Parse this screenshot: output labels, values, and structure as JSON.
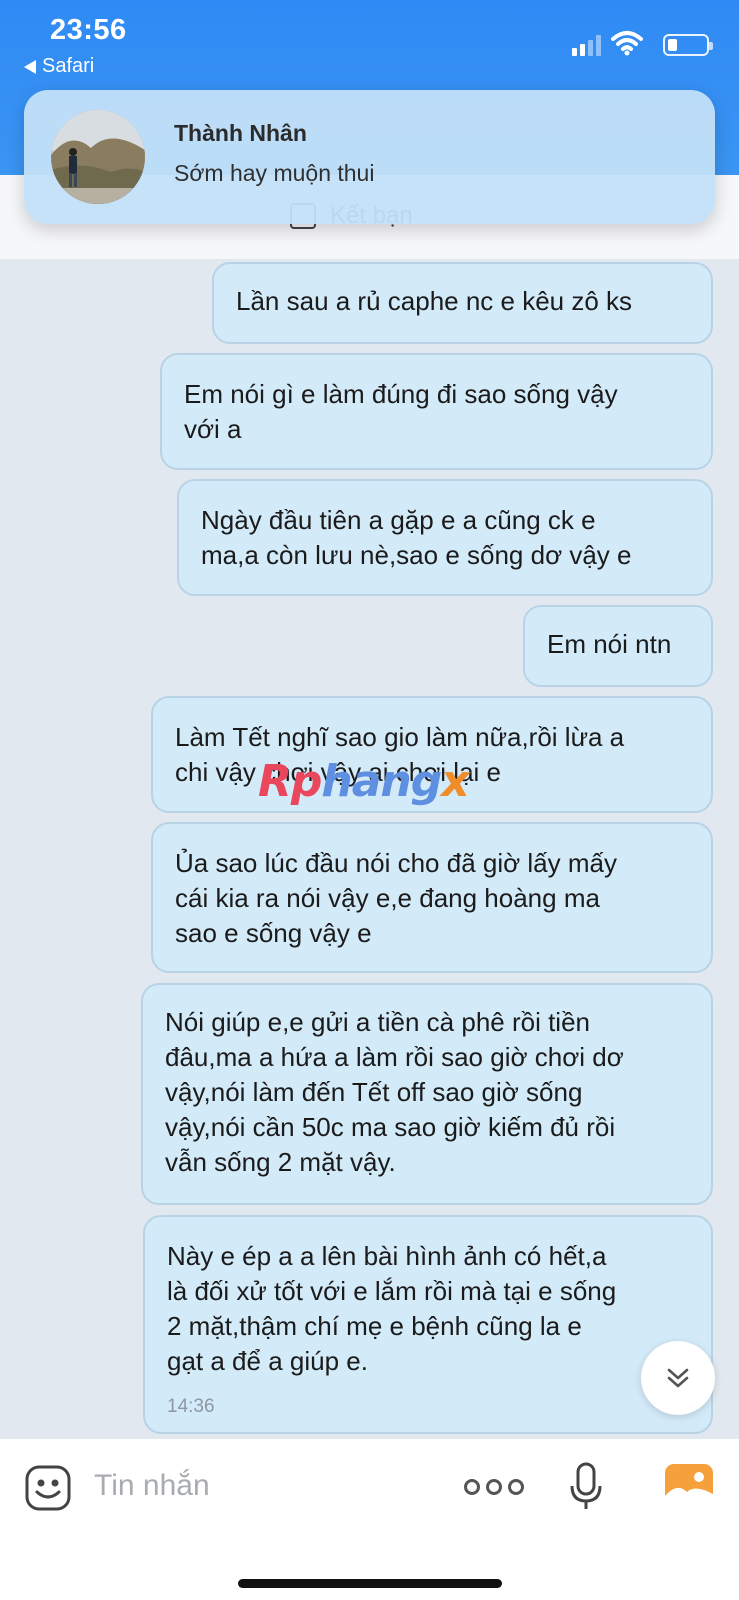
{
  "status": {
    "time": "23:56",
    "back_app": "Safari"
  },
  "notification": {
    "sender": "Thành Nhân",
    "message": "Sớm hay muộn thui"
  },
  "friend_bar": {
    "label": "Kết bạn"
  },
  "messages": [
    {
      "text": "Lần sau a rủ caphe nc e kêu zô ks"
    },
    {
      "text": "Em nói gì e làm đúng đi sao sống vậy\nvới a"
    },
    {
      "text": "Ngày đầu tiên a gặp e a cũng ck e\nma,a còn lưu nè,sao e sống dơ vậy e"
    },
    {
      "text": "Em nói ntn"
    },
    {
      "text": "Làm Tết nghĩ sao gio làm nữa,rồi lừa a\nchi vậy chơi vậy ai chơi lại e"
    },
    {
      "text": "Ủa sao lúc đầu nói cho đã giờ lấy mấy\ncái kia ra nói vậy e,e đang hoàng ma\nsao e sống vậy e"
    },
    {
      "text": "Nói giúp e,e gửi a tiền cà phê rồi tiền\nđâu,ma a hứa a làm rồi sao giờ chơi dơ\nvậy,nói làm đến Tết off sao giờ sống\nvậy,nói cần 50c ma sao giờ kiếm đủ rồi\nvẫn sống 2 mặt vậy."
    },
    {
      "text": "Này e ép a a lên bài hình ảnh có hết,a\nlà đối xử tốt với e lắm rồi mà tại e sống\n2 mặt,thậm chí mẹ e bệnh cũng la e\ngạt a để a giúp e.",
      "time": "14:36"
    }
  ],
  "watermark": {
    "part1": "Rp",
    "part2": "hang",
    "part3": "x"
  },
  "input": {
    "placeholder": "Tin nhắn"
  }
}
